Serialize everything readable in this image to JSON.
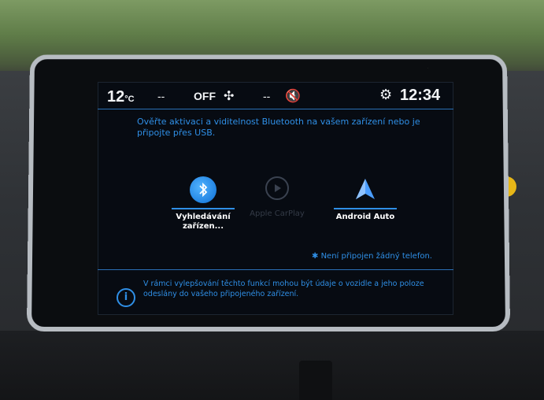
{
  "status_bar": {
    "temperature": "12",
    "temperature_unit": "°C",
    "left_placeholder": "--",
    "fan_state": "OFF",
    "fan_icon": "fan-icon",
    "right_placeholder": "--",
    "mute_icon": "mute-icon",
    "settings_icon": "gear-icon",
    "clock": "12:34"
  },
  "message": "Ověřte aktivaci a viditelnost Bluetooth na vašem zařízení nebo je připojte přes USB.",
  "apps": [
    {
      "label": "Vyhledávání zařízen...",
      "icon": "bluetooth-icon",
      "enabled": true
    },
    {
      "label": "Apple CarPlay",
      "icon": "carplay-play-icon",
      "enabled": false
    },
    {
      "label": "Android Auto",
      "icon": "android-auto-icon",
      "enabled": true
    }
  ],
  "phone_status": "Není připojen žádný telefon.",
  "bottom_note": "V rámci vylepšování těchto funkcí mohou být údaje o vozidle a jeho poloze odeslány do vašeho připojeného zařízení.",
  "colors": {
    "accent_blue": "#2f8fe6",
    "screen_bg": "#070b12",
    "mute_red": "#e14a6a"
  }
}
